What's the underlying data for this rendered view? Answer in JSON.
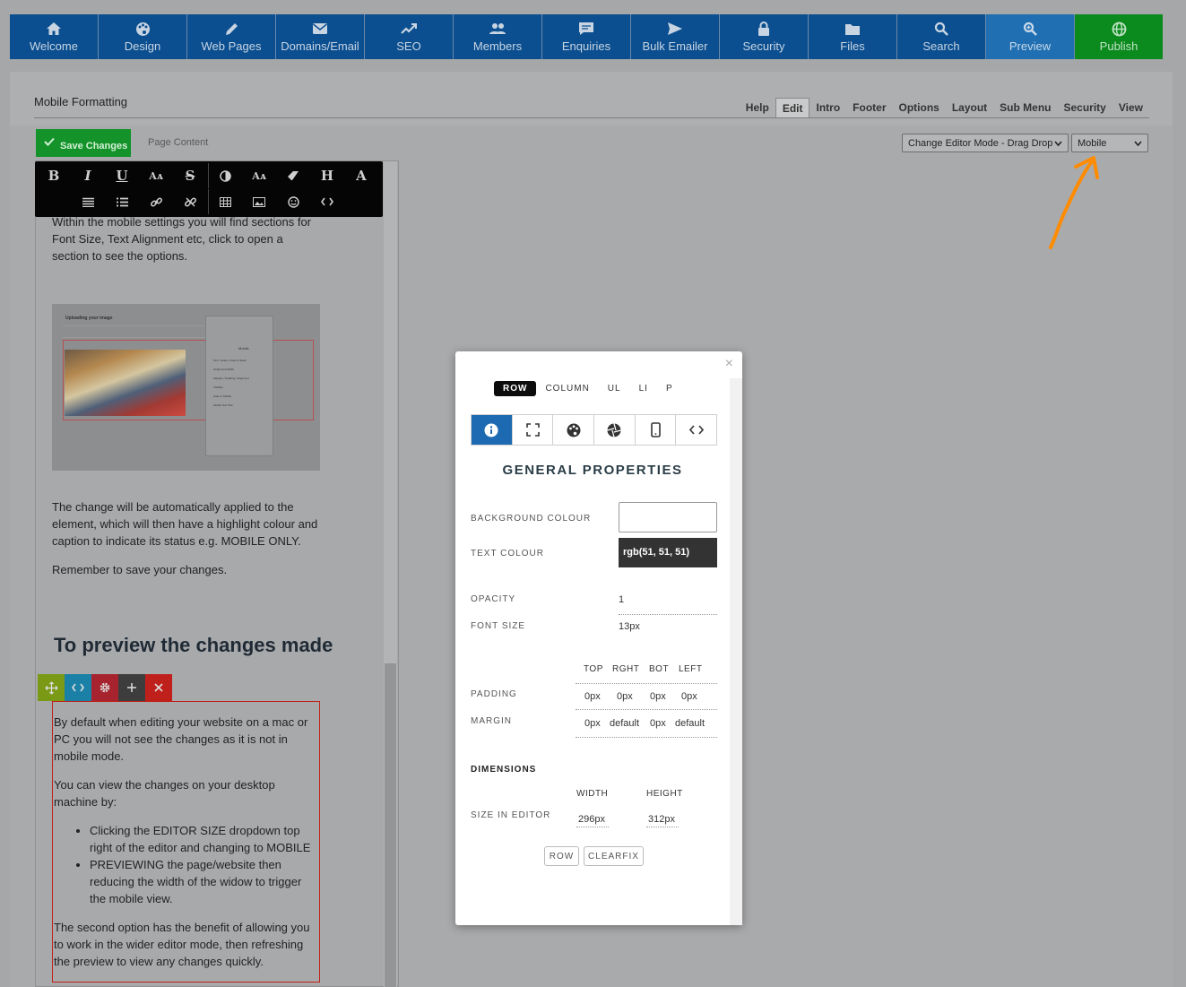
{
  "nav": {
    "items": [
      {
        "label": "Welcome",
        "icon": "home-icon"
      },
      {
        "label": "Design",
        "icon": "palette-icon"
      },
      {
        "label": "Web Pages",
        "icon": "pencil-icon"
      },
      {
        "label": "Domains/Email",
        "icon": "envelope-icon"
      },
      {
        "label": "SEO",
        "icon": "chart-line-icon"
      },
      {
        "label": "Members",
        "icon": "users-icon"
      },
      {
        "label": "Enquiries",
        "icon": "chat-icon"
      },
      {
        "label": "Bulk Emailer",
        "icon": "send-icon"
      },
      {
        "label": "Security",
        "icon": "lock-icon"
      },
      {
        "label": "Files",
        "icon": "folder-icon"
      },
      {
        "label": "Search",
        "icon": "search-icon"
      },
      {
        "label": "Preview",
        "icon": "zoom-icon"
      },
      {
        "label": "Publish",
        "icon": "globe-icon"
      }
    ]
  },
  "page": {
    "title": "Mobile Formatting",
    "tabs": [
      "Help",
      "Edit",
      "Intro",
      "Footer",
      "Options",
      "Layout",
      "Sub Menu",
      "Security",
      "View"
    ],
    "active_tab": "Edit",
    "save_label": "Save Changes",
    "content_label": "Page Content",
    "editor_mode": "Change Editor Mode - Drag Drop",
    "editor_size": "Mobile"
  },
  "editor": {
    "para1": "Within the mobile settings you will find sections for Font Size, Text Alignment etc, click to open a section to see the options.",
    "para2": "The change will be automatically applied to the element, which will then have a highlight colour and caption to indicate its status e.g. MOBILE ONLY.",
    "para3": "Remember to save your changes.",
    "heading": "To preview the changes made",
    "para4": "By default when editing your website on a mac or PC you will not see the changes as it is not in mobile mode.",
    "para5": "You can view the changes on your desktop machine by:",
    "bullets": [
      "Clicking the EDITOR SIZE dropdown top right of the editor and changing to MOBILE",
      "PREVIEWING the page/website then reducing the width of the widow to trigger the mobile view."
    ],
    "para6": "The second option has the benefit of allowing you to work in the wider editor mode, then refreshing the preview to view any changes quickly.",
    "image_caption": "Uploading your image",
    "image_panel_title": "Mobile",
    "image_panel_rows": [
      "Text / Scale / Column Stack",
      "Height and Width",
      "Margins / Padding / Alignment",
      "Visibility",
      "Hide on Mobile",
      "Mobile Text Size"
    ]
  },
  "modal": {
    "tabs": [
      "ROW",
      "COLUMN",
      "UL",
      "LI",
      "P"
    ],
    "active_tab": "ROW",
    "icon_tabs": [
      "info-icon",
      "expand-icon",
      "palette-icon",
      "aperture-icon",
      "mobile-icon",
      "code-icon"
    ],
    "title": "GENERAL PROPERTIES",
    "background_colour_label": "BACKGROUND COLOUR",
    "text_colour_label": "TEXT COLOUR",
    "text_colour_value": "rgb(51, 51, 51)",
    "opacity_label": "OPACITY",
    "opacity_value": "1",
    "font_size_label": "FONT SIZE",
    "font_size_value": "13px",
    "box_headers": [
      "TOP",
      "RGHT",
      "BOT",
      "LEFT"
    ],
    "padding_label": "PADDING",
    "padding_values": [
      "0px",
      "0px",
      "0px",
      "0px"
    ],
    "margin_label": "MARGIN",
    "margin_values": [
      "0px",
      "default",
      "0px",
      "default"
    ],
    "dimensions_label": "DIMENSIONS",
    "width_label": "WIDTH",
    "height_label": "HEIGHT",
    "size_label": "SIZE IN EDITOR",
    "width_value": "296px",
    "height_value": "312px",
    "row_button": "ROW",
    "clearfix_button": "CLEARFIX"
  },
  "colors": {
    "nav_blue": "#0b4f90",
    "preview_blue": "#1f6fb2",
    "publish_green": "#0b8a1e",
    "save_green": "#139329",
    "selection_red": "#c0201b",
    "annotation_orange": "#ff8c00",
    "modal_active_tab": "#1d6ab2"
  }
}
